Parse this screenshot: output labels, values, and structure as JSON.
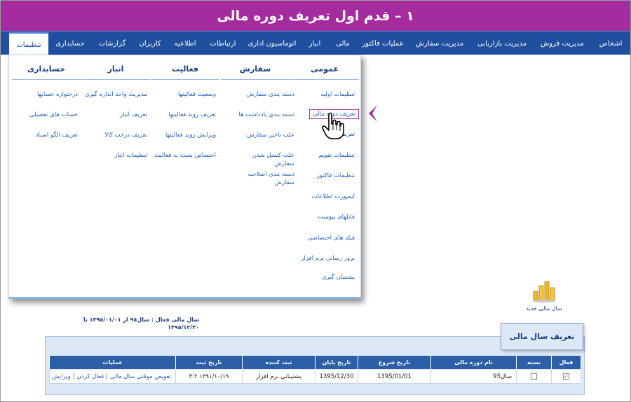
{
  "banner": {
    "title": "١ – قدم  اول تعریف دوره مالی"
  },
  "nav": {
    "items": [
      {
        "key": "settings",
        "label": "تنظیمات"
      },
      {
        "key": "accounting",
        "label": "حسابداری"
      },
      {
        "key": "reports",
        "label": "گزارشات"
      },
      {
        "key": "users",
        "label": "کاربران"
      },
      {
        "key": "notices",
        "label": "اطلاعیه"
      },
      {
        "key": "communications",
        "label": "ارتباطات"
      },
      {
        "key": "office-automation",
        "label": "اتوماسیون اداری"
      },
      {
        "key": "warehouse",
        "label": "انبار"
      },
      {
        "key": "financial",
        "label": "مالی"
      },
      {
        "key": "invoice-ops",
        "label": "عملیات فاکتور"
      },
      {
        "key": "order-management",
        "label": "مدیریت سفارش"
      },
      {
        "key": "marketing-management",
        "label": "مدیریت بازاریابی"
      },
      {
        "key": "sales-management",
        "label": "مدیریت فروش"
      },
      {
        "key": "persons",
        "label": "اشخاص"
      }
    ]
  },
  "menu": {
    "general": {
      "title": "عمومی",
      "items": [
        "تنظیمات اولیه",
        "تعریف دوره مالی",
        "تعریف",
        "تنظیمات تقویم",
        "تنظیمات فاکتور",
        "ایمپورت اطلاعات",
        "فایلهای پیوست",
        "فیلد های اختصاصی",
        "بروز رسانی نرم افزار",
        "پشتیبان گیری"
      ]
    },
    "order": {
      "title": "سفارش",
      "items": [
        "دسته بندی سفارش",
        "دسته بندی یادداشت ها",
        "علت تاخیر سفارش",
        "علت کنسل شدن سفارش",
        "دسته بندی اصلاحیه سفارش"
      ]
    },
    "activity": {
      "title": "فعالیت",
      "items": [
        "وضعیت فعالیتها",
        "تعریف روند فعالیتها",
        "ویرایش روند فعالیتها",
        "اختصاص پست به فعالیت"
      ]
    },
    "warehouse": {
      "title": "انبار",
      "items": [
        "مدیریت واحد اندازه گیری",
        "تعریف انبار",
        "تعریف درخت کالا",
        "تنظیمات انبار"
      ]
    },
    "accounting": {
      "title": "حسابداری",
      "items": [
        "درختواره حسابها",
        "حساب های تفصیلی",
        "تعریف الگو اسناد"
      ]
    }
  },
  "new_year": {
    "label": "سال مالی جدید"
  },
  "active_year": {
    "text": "سال مالی فعال : سال٩٥ از ١٣٩٥/٠١/٠١ تا ١٣٩٥/١٢/٣٠"
  },
  "panel": {
    "tab_label": "تعریف سال مالی"
  },
  "grid": {
    "headers": {
      "active": "فعال",
      "closed": "بسته",
      "name": "نام دوره مالی",
      "start": "تاریخ شروع",
      "end": "تاریخ پایان",
      "registrar": "ثبت کننده",
      "reg_date": "تاریخ ثبت",
      "ops": "عملیات"
    },
    "row": {
      "name": "سال95",
      "start": "1395/01/01",
      "end": "1395/12/30",
      "registrar": "پشتیبانی نرم افزار",
      "reg_date": "١٣٩١/١٠/١٩  ٣:٢",
      "op_swap": "تعویض موقتی سال مالی",
      "op_activate": "فعال کردن",
      "op_edit": "ویرایش",
      "active_mark": "✓"
    }
  },
  "colors": {
    "banner": "#a52c9f",
    "nav": "#1f4f9e",
    "link": "#2360b8",
    "grid_header": "#2d5fa8",
    "panel": "#dde8f6"
  },
  "icons": [
    "hand-cursor-icon",
    "left-arrow-icon",
    "coins-chart-icon",
    "checkbox-icon"
  ]
}
